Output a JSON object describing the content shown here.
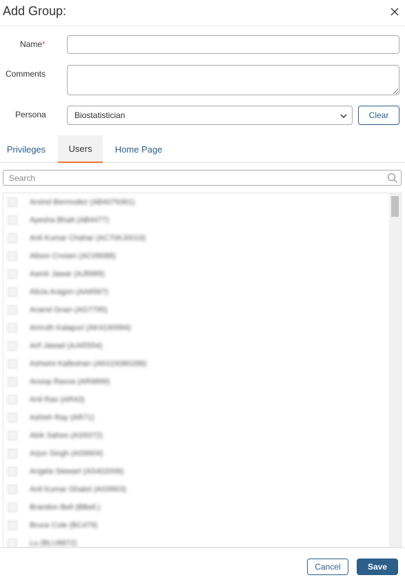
{
  "dialog": {
    "title": "Add Group:",
    "close_icon": "close-icon"
  },
  "form": {
    "name_label": "Name",
    "name_required_mark": "*",
    "name_value": "",
    "comments_label": "Comments",
    "comments_value": "",
    "persona_label": "Persona",
    "persona_selected": "Biostatistician",
    "clear_label": "Clear"
  },
  "tabs": [
    {
      "label": "Privileges",
      "active": false
    },
    {
      "label": "Users",
      "active": true
    },
    {
      "label": "Home Page",
      "active": false
    }
  ],
  "search": {
    "placeholder": "Search",
    "icon": "search-icon"
  },
  "users": [
    "Arvind Bermudez (AB4079361)",
    "Ayesha Bhatt (AB4477)",
    "Anil Kumar Chahar (AC70KJ0019)",
    "Alison Crosen (AC09088)",
    "Aamir Jawar (AJ8989)",
    "Alicia Aragon (AA6567)",
    "Anand Gnan (AG7795)",
    "Amruth Kalapuri (AK4190994)",
    "Arif Jawad (AJ45554)",
    "Ashwini Kalleshan (AK019380288)",
    "Anoop Ravva (AR9899)",
    "Anil Rao (AR43)",
    "Ashish Ray (AR71)",
    "Alok Sahoo (AS9372)",
    "Arjun Singh (AS9904)",
    "Angela Stewart (AS402006)",
    "Anil Kumar Ghalot (AG9903)",
    "Brandon Bell (BBell.)",
    "Bruce Cole (BC479)",
    "Lu (BLU8872)"
  ],
  "footer": {
    "cancel_label": "Cancel",
    "save_label": "Save"
  },
  "colors": {
    "accent": "#2c5f8a",
    "active_tab_underline": "#e8762c",
    "required": "#d9534f"
  }
}
